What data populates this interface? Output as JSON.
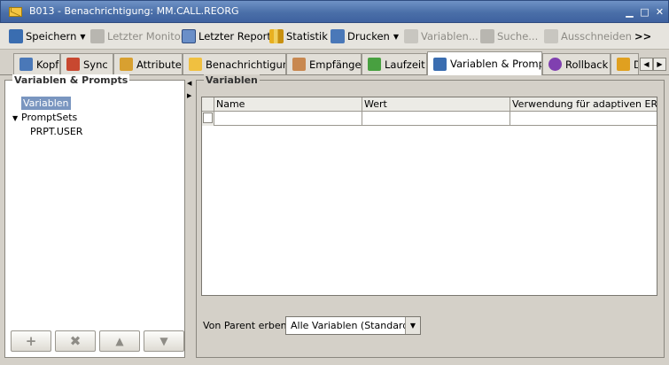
{
  "window": {
    "title": "B013 - Benachrichtigung: MM.CALL.REORG",
    "minimize": "▁",
    "maximize": "□",
    "close": "✕"
  },
  "toolbar": {
    "save": "Speichern",
    "last_monitor": "Letzter Monitor",
    "last_report": "Letzter Report",
    "statistics": "Statistik",
    "print": "Drucken",
    "variables": "Variablen...",
    "search": "Suche...",
    "cut": "Ausschneiden",
    "more": ">>"
  },
  "tabs": [
    {
      "label": "Kopf"
    },
    {
      "label": "Sync"
    },
    {
      "label": "Attribute"
    },
    {
      "label": "Benachrichtigung"
    },
    {
      "label": "Empfänger"
    },
    {
      "label": "Laufzeit"
    },
    {
      "label": "Variablen & Prompts"
    },
    {
      "label": "Rollback"
    },
    {
      "label": "D"
    }
  ],
  "left_panel": {
    "title": "Variablen & Prompts",
    "tree": {
      "variables": "Variablen",
      "promptsets": "PromptSets",
      "prompt_user": "PRPT.USER"
    },
    "buttons": {
      "add": "+",
      "delete": "✖",
      "up": "▲",
      "down": "▼"
    }
  },
  "right_panel": {
    "title": "Variablen",
    "columns": [
      "Name",
      "Wert",
      "Verwendung für adaptiven ERT..."
    ],
    "inherit_label": "Von Parent erben:",
    "inherit_value": "Alle Variablen (Standard)"
  },
  "colors": {
    "titlebar": "#4a6fa8",
    "selection": "#7a96c0",
    "panel_bg": "#d4d0c8"
  }
}
